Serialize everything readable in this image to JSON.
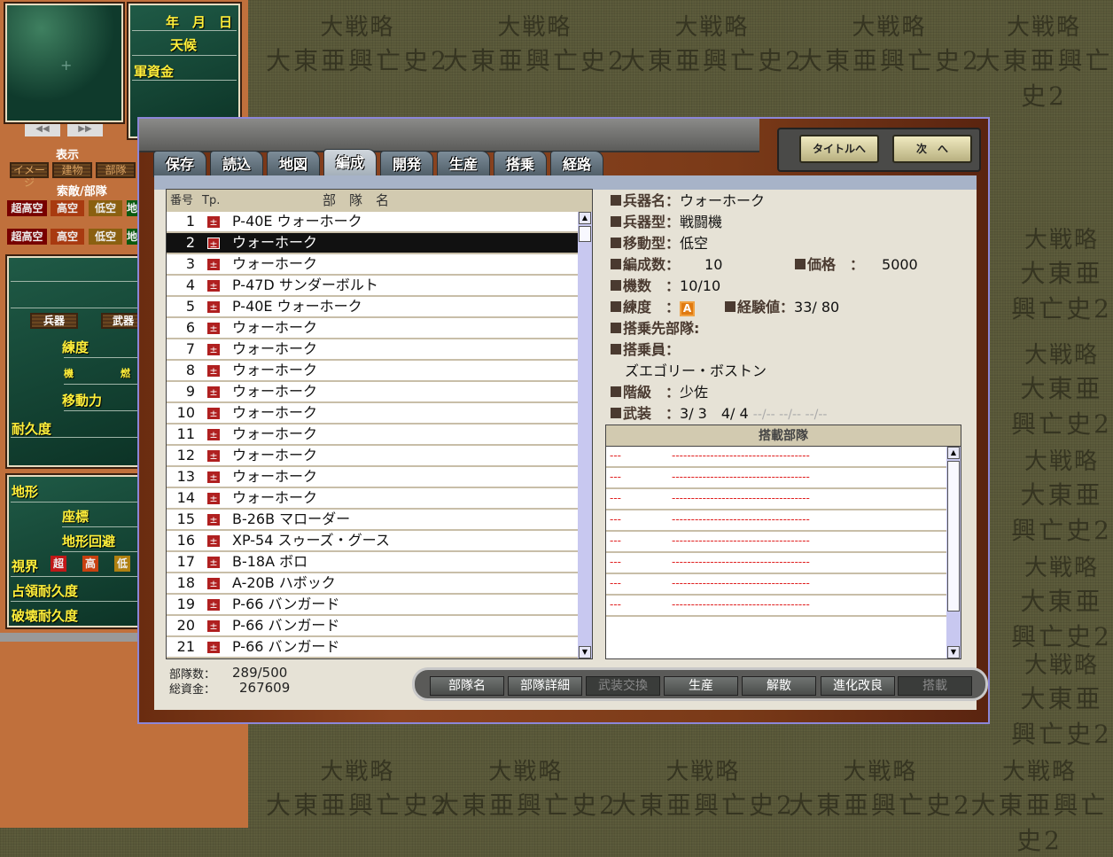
{
  "watermark": {
    "line1": "大戦略",
    "line2": "大東亜興亡史2"
  },
  "left": {
    "nav": {
      "prev": "◀◀",
      "next": "▶▶"
    },
    "info": {
      "date": "年　月　日",
      "weather": "天候",
      "funds": "軍資金"
    },
    "display": {
      "title": "表示",
      "buttons": [
        "イメージ",
        "建物",
        "部隊"
      ]
    },
    "search": {
      "title": "索敵/部隊",
      "rows": [
        [
          "超高空",
          "高空",
          "低空",
          "地"
        ],
        [
          "超高空",
          "高空",
          "低空",
          "地"
        ]
      ]
    },
    "unit": {
      "weapon_btn": "兵器",
      "arms_btn": "武器",
      "skill": "練度",
      "machine": "機",
      "fuel": "燃",
      "move": "移動力",
      "durability": "耐久度"
    },
    "terrain": {
      "title": "地形",
      "coord": "座標",
      "evade": "地形回避",
      "vision": "視界",
      "vision_tags": [
        "超",
        "高",
        "低"
      ],
      "occupy": "占領耐久度",
      "destroy": "破壊耐久度"
    }
  },
  "dialog": {
    "tabs": [
      "保存",
      "読込",
      "地図",
      "編成",
      "開発",
      "生産",
      "搭乗",
      "経路"
    ],
    "active_tab": "編成",
    "title_button": "タイトルへ",
    "next_button": "次　へ",
    "list": {
      "headers": {
        "no": "番号",
        "type": "Tp.",
        "name": "部　隊　名"
      },
      "selected": 2,
      "rows": [
        {
          "no": "1",
          "name": "P-40E ウォーホーク"
        },
        {
          "no": "2",
          "name": "ウォーホーク"
        },
        {
          "no": "3",
          "name": "ウォーホーク"
        },
        {
          "no": "4",
          "name": "P-47D サンダーボルト"
        },
        {
          "no": "5",
          "name": "P-40E ウォーホーク"
        },
        {
          "no": "6",
          "name": "ウォーホーク"
        },
        {
          "no": "7",
          "name": "ウォーホーク"
        },
        {
          "no": "8",
          "name": "ウォーホーク"
        },
        {
          "no": "9",
          "name": "ウォーホーク"
        },
        {
          "no": "10",
          "name": "ウォーホーク"
        },
        {
          "no": "11",
          "name": "ウォーホーク"
        },
        {
          "no": "12",
          "name": "ウォーホーク"
        },
        {
          "no": "13",
          "name": "ウォーホーク"
        },
        {
          "no": "14",
          "name": "ウォーホーク"
        },
        {
          "no": "15",
          "name": "B-26B マローダー"
        },
        {
          "no": "16",
          "name": "XP-54 スゥーズ・グース"
        },
        {
          "no": "17",
          "name": "B-18A ボロ"
        },
        {
          "no": "18",
          "name": "A-20B ハボック"
        },
        {
          "no": "19",
          "name": "P-66 バンガード"
        },
        {
          "no": "20",
          "name": "P-66 バンガード"
        },
        {
          "no": "21",
          "name": "P-66 バンガード"
        }
      ]
    },
    "stats": {
      "units_label": "部隊数：",
      "units_value": "289/500",
      "funds_label": "総資金：",
      "funds_value": "267609"
    },
    "detail": {
      "weapon_name_label": "兵器名：",
      "weapon_name": "ウォーホーク",
      "weapon_type_label": "兵器型：",
      "weapon_type": "戦闘機",
      "move_type_label": "移動型：",
      "move_type": "低空",
      "formation_label": "編成数：",
      "formation": "10",
      "price_label": "価格　：",
      "price": "5000",
      "count_label": "機数　：",
      "count": "10/10",
      "skill_label": "練度　：",
      "skill": "A",
      "exp_label": "経験値：",
      "exp": "33/ 80",
      "carrier_label": "搭乗先部隊:",
      "crew_label": "搭乗員：",
      "crew": "ズエゴリー・ボストン",
      "rank_label": "階級　：",
      "rank": "少佐",
      "arms_label": "武装　：",
      "arms": "3/ 3　4/ 4",
      "arms_empty": "--/-- --/-- --/--"
    },
    "cargo": {
      "title": "搭載部隊",
      "rows": 8,
      "dash_a": "---",
      "dash_b": "------------------------------------"
    },
    "buttons": [
      {
        "label": "部隊名",
        "enabled": true
      },
      {
        "label": "部隊詳細",
        "enabled": true
      },
      {
        "label": "武装交換",
        "enabled": false
      },
      {
        "label": "生産",
        "enabled": true
      },
      {
        "label": "解散",
        "enabled": true
      },
      {
        "label": "進化改良",
        "enabled": true
      },
      {
        "label": "搭載",
        "enabled": false
      }
    ]
  }
}
